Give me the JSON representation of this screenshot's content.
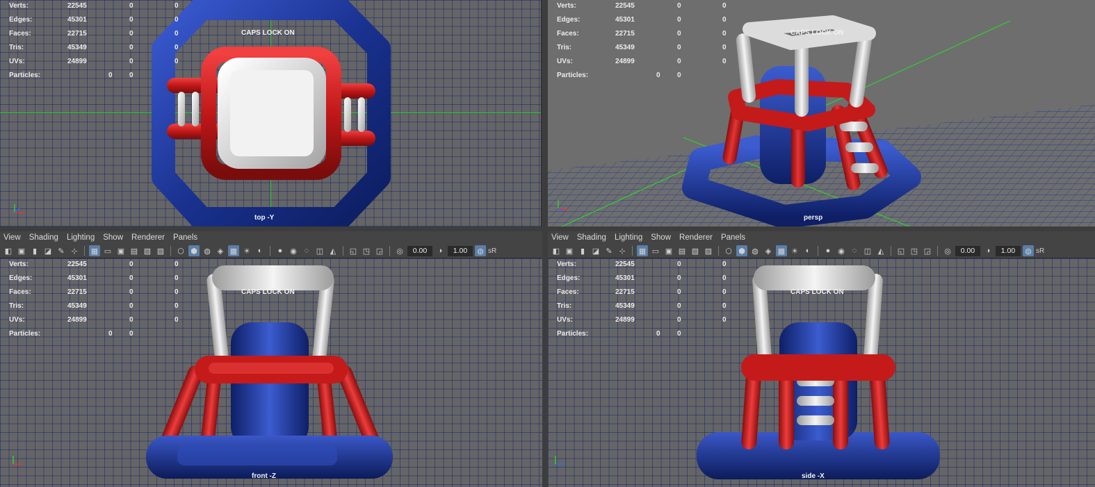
{
  "hud_stats": [
    {
      "label": "Verts:",
      "v1": "22545",
      "v2": "0",
      "v3": "0"
    },
    {
      "label": "Edges:",
      "v1": "45301",
      "v2": "0",
      "v3": "0"
    },
    {
      "label": "Faces:",
      "v1": "22715",
      "v2": "0",
      "v3": "0"
    },
    {
      "label": "Tris:",
      "v1": "45349",
      "v2": "0",
      "v3": "0"
    },
    {
      "label": "UVs:",
      "v1": "24899",
      "v2": "0",
      "v3": "0"
    },
    {
      "label": "Particles:",
      "v1": "",
      "v2": "0",
      "v3": "0"
    }
  ],
  "caps_lock": "CAPS LOCK ON",
  "viewports": {
    "top": {
      "camera": "top -Y"
    },
    "persp": {
      "camera": "persp"
    },
    "front": {
      "camera": "front -Z"
    },
    "side": {
      "camera": "side -X"
    }
  },
  "menu": {
    "view": "View",
    "shading": "Shading",
    "lighting": "Lighting",
    "show": "Show",
    "renderer": "Renderer",
    "panels": "Panels"
  },
  "toolbar": {
    "exposure": "0.00",
    "gamma": "1.00",
    "color_space": "sR"
  },
  "colors": {
    "blue": "#1f3a9c",
    "red": "#c01818",
    "white": "#e4e4e4",
    "grid": "#1e3c8c",
    "axis": "#2fd12f"
  }
}
